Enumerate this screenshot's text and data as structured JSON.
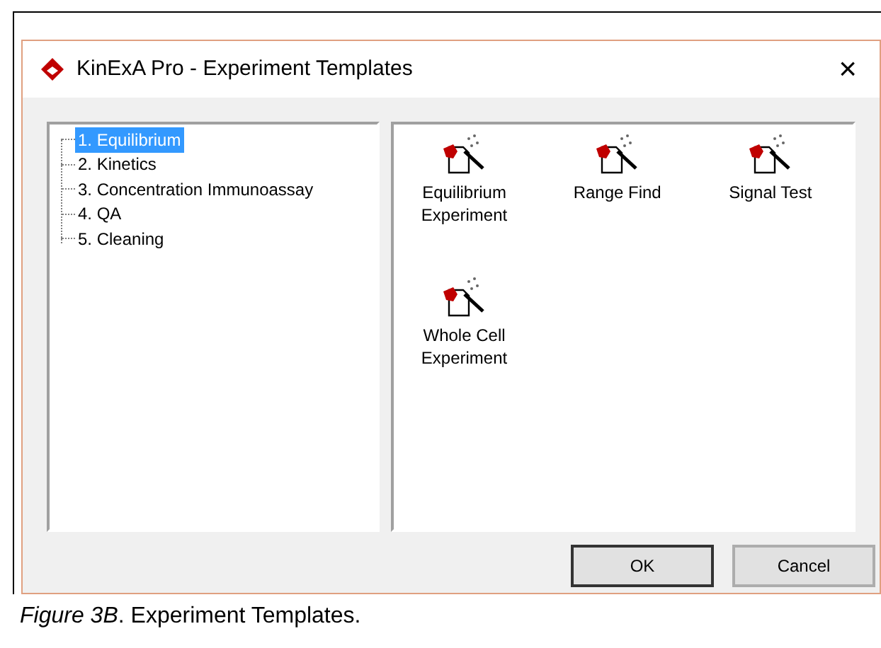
{
  "window": {
    "title": "KinExA Pro - Experiment Templates",
    "close": "×"
  },
  "tree": [
    {
      "label": "1. Equilibrium",
      "selected": true
    },
    {
      "label": "2. Kinetics",
      "selected": false
    },
    {
      "label": "3. Concentration Immunoassay",
      "selected": false
    },
    {
      "label": "4. QA",
      "selected": false
    },
    {
      "label": "5. Cleaning",
      "selected": false
    }
  ],
  "templates": [
    {
      "label": "Equilibrium Experiment"
    },
    {
      "label": "Range Find"
    },
    {
      "label": "Signal Test"
    },
    {
      "label": "Whole Cell Experiment"
    }
  ],
  "buttons": [
    {
      "label": "OK",
      "default": true
    },
    {
      "label": "Cancel",
      "default": false
    }
  ],
  "caption": "*Figure 3B*. Experiment Templates."
}
